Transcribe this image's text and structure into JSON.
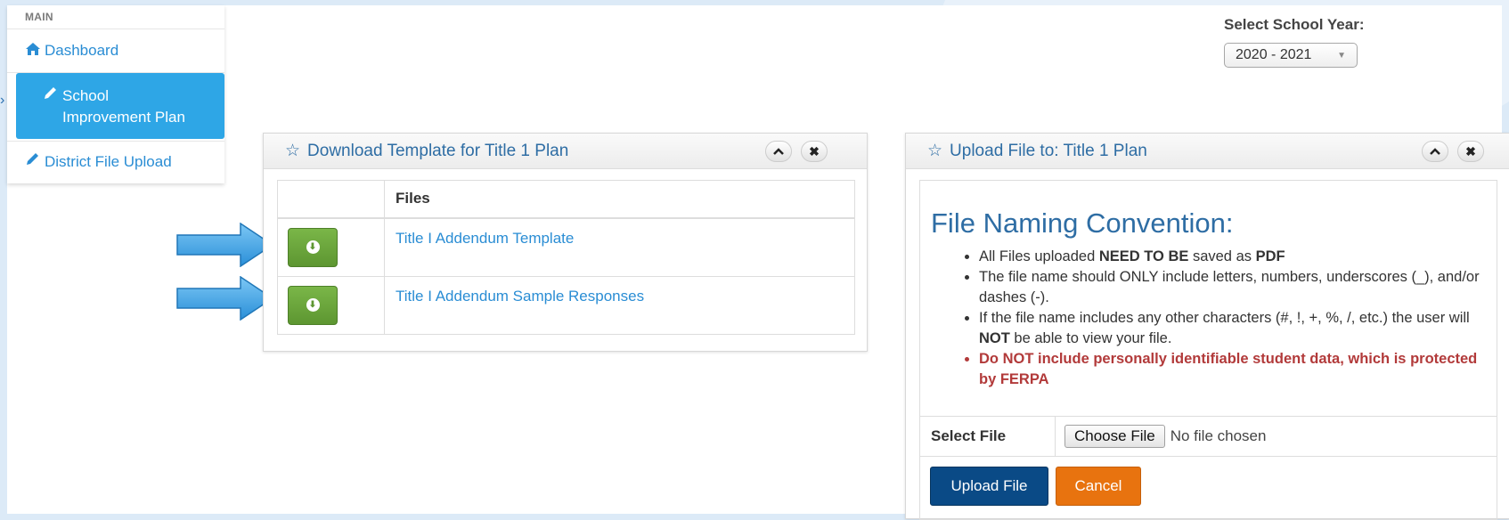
{
  "sidebar": {
    "section_label": "MAIN",
    "items": [
      {
        "label": "Dashboard",
        "icon": "home-icon"
      },
      {
        "label": "School Improvement Plan",
        "icon": "pencil-icon",
        "active": true
      },
      {
        "label": "District File Upload",
        "icon": "pencil-icon"
      }
    ]
  },
  "school_year": {
    "label": "Select School Year:",
    "selected": "2020 - 2021"
  },
  "download_panel": {
    "title": "Download Template for Title 1 Plan",
    "table": {
      "headers": [
        "",
        "Files"
      ],
      "rows": [
        {
          "file": "Title I Addendum Template"
        },
        {
          "file": "Title I Addendum Sample Responses"
        }
      ]
    }
  },
  "upload_panel": {
    "title": "Upload File to: Title 1 Plan",
    "naming_title": "File Naming Convention:",
    "rules": {
      "r1_a": "All Files uploaded ",
      "r1_b": "NEED TO BE",
      "r1_c": " saved as ",
      "r1_d": "PDF",
      "r2": "The file name should ONLY include letters, numbers, underscores (_), and/or dashes (-).",
      "r3_a": "If the file name includes any other characters (#, !, +, %, /, etc.) the user will ",
      "r3_b": "NOT",
      "r3_c": " be able to view your file.",
      "r4": "Do NOT include personally identifiable student data, which is protected by FERPA"
    },
    "select_file_label": "Select File",
    "choose_file_label": "Choose File",
    "no_file_text": "No file chosen",
    "upload_label": "Upload File",
    "cancel_label": "Cancel"
  },
  "colors": {
    "accent": "#2ea6e6",
    "link": "#2a8dd4",
    "panel_title": "#2e6da4",
    "download_button": "#6aa63c",
    "upload_button": "#0a4a86",
    "cancel_button": "#e8730f",
    "warning_text": "#b23a3a",
    "arrow": "#3aa3e6"
  }
}
